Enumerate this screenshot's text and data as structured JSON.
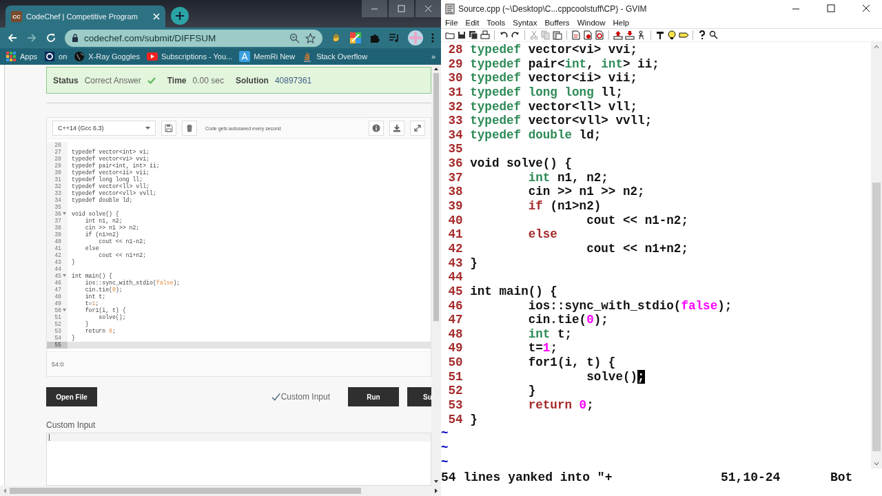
{
  "browser": {
    "tab": {
      "favicon_text": "CC",
      "title": "CodeChef | Competitive Program"
    },
    "address": "codechef.com/submit/DIFFSUM",
    "bookmarks": [
      {
        "label": "Apps"
      },
      {
        "label": "on"
      },
      {
        "label": "X-Ray Goggles"
      },
      {
        "label": "Subscriptions - You..."
      },
      {
        "label": "MemRi New"
      },
      {
        "label": "Stack Overflow"
      }
    ],
    "bookmarks_more": "»",
    "result": {
      "status_label": "Status",
      "status_value": "Correct Answer",
      "time_label": "Time",
      "time_value": "0.00 sec",
      "solution_label": "Solution",
      "solution_value": "40897361"
    },
    "editor": {
      "language": "C++14 (Gcc 6.3)",
      "autosave_note": "Code gets autosaved every second",
      "cursor_position": "54:0",
      "lines": [
        {
          "number": "26",
          "fold": false,
          "active": false
        },
        {
          "number": "27",
          "fold": false,
          "active": false,
          "segments": [
            {
              "text": "typedef vector<int> vi;",
              "kind": "plain"
            }
          ]
        },
        {
          "number": "28",
          "fold": false,
          "active": false,
          "segments": [
            {
              "text": "typedef vector<vi> vvi;",
              "kind": "plain"
            }
          ]
        },
        {
          "number": "29",
          "fold": false,
          "active": false,
          "segments": [
            {
              "text": "typedef pair<int, int> ii;",
              "kind": "plain"
            }
          ]
        },
        {
          "number": "30",
          "fold": false,
          "active": false,
          "segments": [
            {
              "text": "typedef vector<ii> vii;",
              "kind": "plain"
            }
          ]
        },
        {
          "number": "31",
          "fold": false,
          "active": false,
          "segments": [
            {
              "text": "typedef long long ll;",
              "kind": "plain"
            }
          ]
        },
        {
          "number": "32",
          "fold": false,
          "active": false,
          "segments": [
            {
              "text": "typedef vector<ll> vll;",
              "kind": "plain"
            }
          ]
        },
        {
          "number": "33",
          "fold": false,
          "active": false,
          "segments": [
            {
              "text": "typedef vector<vll> vvll;",
              "kind": "plain"
            }
          ]
        },
        {
          "number": "34",
          "fold": false,
          "active": false,
          "segments": [
            {
              "text": "typedef double ld;",
              "kind": "plain"
            }
          ]
        },
        {
          "number": "35",
          "fold": false,
          "active": false
        },
        {
          "number": "36",
          "fold": true,
          "active": false,
          "segments": [
            {
              "text": "void solve() {",
              "kind": "plain"
            }
          ]
        },
        {
          "number": "37",
          "fold": false,
          "active": false,
          "segments": [
            {
              "text": "    int n1, n2;",
              "kind": "plain"
            }
          ]
        },
        {
          "number": "38",
          "fold": false,
          "active": false,
          "segments": [
            {
              "text": "    cin >> n1 >> n2;",
              "kind": "plain"
            }
          ]
        },
        {
          "number": "39",
          "fold": false,
          "active": false,
          "segments": [
            {
              "text": "    if (n1>n2)",
              "kind": "plain"
            }
          ]
        },
        {
          "number": "40",
          "fold": false,
          "active": false,
          "segments": [
            {
              "text": "        cout << n1-n2;",
              "kind": "plain"
            }
          ]
        },
        {
          "number": "41",
          "fold": false,
          "active": false,
          "segments": [
            {
              "text": "    else",
              "kind": "plain"
            }
          ]
        },
        {
          "number": "42",
          "fold": false,
          "active": false,
          "segments": [
            {
              "text": "        cout << n1+n2;",
              "kind": "plain"
            }
          ]
        },
        {
          "number": "43",
          "fold": false,
          "active": false,
          "segments": [
            {
              "text": "}",
              "kind": "plain"
            }
          ]
        },
        {
          "number": "44",
          "fold": false,
          "active": false
        },
        {
          "number": "45",
          "fold": true,
          "active": false,
          "segments": [
            {
              "text": "int main() {",
              "kind": "plain"
            }
          ]
        },
        {
          "number": "46",
          "fold": false,
          "active": false,
          "segments": [
            {
              "text": "    ios::sync_with_stdio(",
              "kind": "plain"
            },
            {
              "text": "false",
              "kind": "literal"
            },
            {
              "text": ");",
              "kind": "plain"
            }
          ]
        },
        {
          "number": "47",
          "fold": false,
          "active": false,
          "segments": [
            {
              "text": "    cin.tie(",
              "kind": "plain"
            },
            {
              "text": "0",
              "kind": "literal"
            },
            {
              "text": ");",
              "kind": "plain"
            }
          ]
        },
        {
          "number": "48",
          "fold": false,
          "active": false,
          "segments": [
            {
              "text": "    int t;",
              "kind": "plain"
            }
          ]
        },
        {
          "number": "49",
          "fold": false,
          "active": false,
          "segments": [
            {
              "text": "    t=",
              "kind": "plain"
            },
            {
              "text": "1",
              "kind": "literal"
            },
            {
              "text": ";",
              "kind": "plain"
            }
          ]
        },
        {
          "number": "50",
          "fold": true,
          "active": false,
          "segments": [
            {
              "text": "    for1(i, t) {",
              "kind": "plain"
            }
          ]
        },
        {
          "number": "51",
          "fold": false,
          "active": false,
          "segments": [
            {
              "text": "        solve();",
              "kind": "plain"
            }
          ]
        },
        {
          "number": "52",
          "fold": false,
          "active": false,
          "segments": [
            {
              "text": "    }",
              "kind": "plain"
            }
          ]
        },
        {
          "number": "53",
          "fold": false,
          "active": false,
          "segments": [
            {
              "text": "    return ",
              "kind": "plain"
            },
            {
              "text": "0",
              "kind": "literal"
            },
            {
              "text": ";",
              "kind": "plain"
            }
          ]
        },
        {
          "number": "54",
          "fold": false,
          "active": false,
          "segments": [
            {
              "text": "}",
              "kind": "plain"
            }
          ]
        },
        {
          "number": "55",
          "fold": false,
          "active": true
        }
      ]
    },
    "open_file_button": "Open File",
    "custom_input_toggle": {
      "label": "Custom Input",
      "checked": true
    },
    "run_button": "Run",
    "submit_button": "Su",
    "custom_input_label": "Custom Input"
  },
  "gvim": {
    "title": "Source.cpp (~\\Desktop\\C...cppcoolstuff\\CP) - GVIM",
    "menu": [
      "File",
      "Edit",
      "Tools",
      "Syntax",
      "Buffers",
      "Window",
      "Help"
    ],
    "lines": [
      {
        "number": "28",
        "segments": [
          {
            "text": "typedef",
            "kind": "type"
          },
          {
            "text": " vector<vi> vvi;",
            "kind": "plain"
          }
        ]
      },
      {
        "number": "29",
        "segments": [
          {
            "text": "typedef",
            "kind": "type"
          },
          {
            "text": " pair<",
            "kind": "plain"
          },
          {
            "text": "int",
            "kind": "type"
          },
          {
            "text": ", ",
            "kind": "plain"
          },
          {
            "text": "int",
            "kind": "type"
          },
          {
            "text": "> ii;",
            "kind": "plain"
          }
        ]
      },
      {
        "number": "30",
        "segments": [
          {
            "text": "typedef",
            "kind": "type"
          },
          {
            "text": " vector<ii> vii;",
            "kind": "plain"
          }
        ]
      },
      {
        "number": "31",
        "segments": [
          {
            "text": "typedef long long",
            "kind": "type"
          },
          {
            "text": " ll;",
            "kind": "plain"
          }
        ]
      },
      {
        "number": "32",
        "segments": [
          {
            "text": "typedef",
            "kind": "type"
          },
          {
            "text": " vector<ll> vll;",
            "kind": "plain"
          }
        ]
      },
      {
        "number": "33",
        "segments": [
          {
            "text": "typedef",
            "kind": "type"
          },
          {
            "text": " vector<vll> vvll;",
            "kind": "plain"
          }
        ]
      },
      {
        "number": "34",
        "segments": [
          {
            "text": "typedef double",
            "kind": "type"
          },
          {
            "text": " ld;",
            "kind": "plain"
          }
        ]
      },
      {
        "number": "35"
      },
      {
        "number": "36",
        "segments": [
          {
            "text": "void solve() {",
            "kind": "plain"
          }
        ]
      },
      {
        "number": "37",
        "segments": [
          {
            "text": "        int",
            "kind": "type"
          },
          {
            "text": " n1, n2;",
            "kind": "plain"
          }
        ]
      },
      {
        "number": "38",
        "segments": [
          {
            "text": "        cin >> n1 >> n2;",
            "kind": "plain"
          }
        ]
      },
      {
        "number": "39",
        "segments": [
          {
            "text": "        if",
            "kind": "statement"
          },
          {
            "text": " (n1>n2)",
            "kind": "plain"
          }
        ]
      },
      {
        "number": "40",
        "segments": [
          {
            "text": "                cout << n1-n2;",
            "kind": "plain"
          }
        ]
      },
      {
        "number": "41",
        "segments": [
          {
            "text": "        else",
            "kind": "statement"
          }
        ]
      },
      {
        "number": "42",
        "segments": [
          {
            "text": "                cout << n1+n2;",
            "kind": "plain"
          }
        ]
      },
      {
        "number": "43",
        "segments": [
          {
            "text": "}",
            "kind": "plain"
          }
        ]
      },
      {
        "number": "44"
      },
      {
        "number": "45",
        "segments": [
          {
            "text": "int main() {",
            "kind": "plain"
          }
        ]
      },
      {
        "number": "46",
        "segments": [
          {
            "text": "        ios::sync_with_stdio(",
            "kind": "plain"
          },
          {
            "text": "false",
            "kind": "constant"
          },
          {
            "text": ");",
            "kind": "plain"
          }
        ]
      },
      {
        "number": "47",
        "segments": [
          {
            "text": "        cin.tie(",
            "kind": "plain"
          },
          {
            "text": "0",
            "kind": "constant"
          },
          {
            "text": ");",
            "kind": "plain"
          }
        ]
      },
      {
        "number": "48",
        "segments": [
          {
            "text": "        int",
            "kind": "type"
          },
          {
            "text": " t;",
            "kind": "plain"
          }
        ]
      },
      {
        "number": "49",
        "segments": [
          {
            "text": "        t=",
            "kind": "plain"
          },
          {
            "text": "1",
            "kind": "constant"
          },
          {
            "text": ";",
            "kind": "plain"
          }
        ]
      },
      {
        "number": "50",
        "segments": [
          {
            "text": "        for1(i, t) {",
            "kind": "plain"
          }
        ]
      },
      {
        "number": "51",
        "segments": [
          {
            "text": "                solve()",
            "kind": "plain"
          },
          {
            "text": ";",
            "kind": "cursor"
          }
        ]
      },
      {
        "number": "52",
        "segments": [
          {
            "text": "        }",
            "kind": "plain"
          }
        ]
      },
      {
        "number": "53",
        "segments": [
          {
            "text": "        return ",
            "kind": "statement"
          },
          {
            "text": "0",
            "kind": "constant"
          },
          {
            "text": ";",
            "kind": "plain"
          }
        ]
      },
      {
        "number": "54",
        "segments": [
          {
            "text": "}",
            "kind": "plain"
          }
        ]
      }
    ],
    "filler_lines": [
      "~",
      "~",
      "~"
    ],
    "message": "54 lines yanked into \"+",
    "position": "51,10-24",
    "scroll": "Bot"
  }
}
